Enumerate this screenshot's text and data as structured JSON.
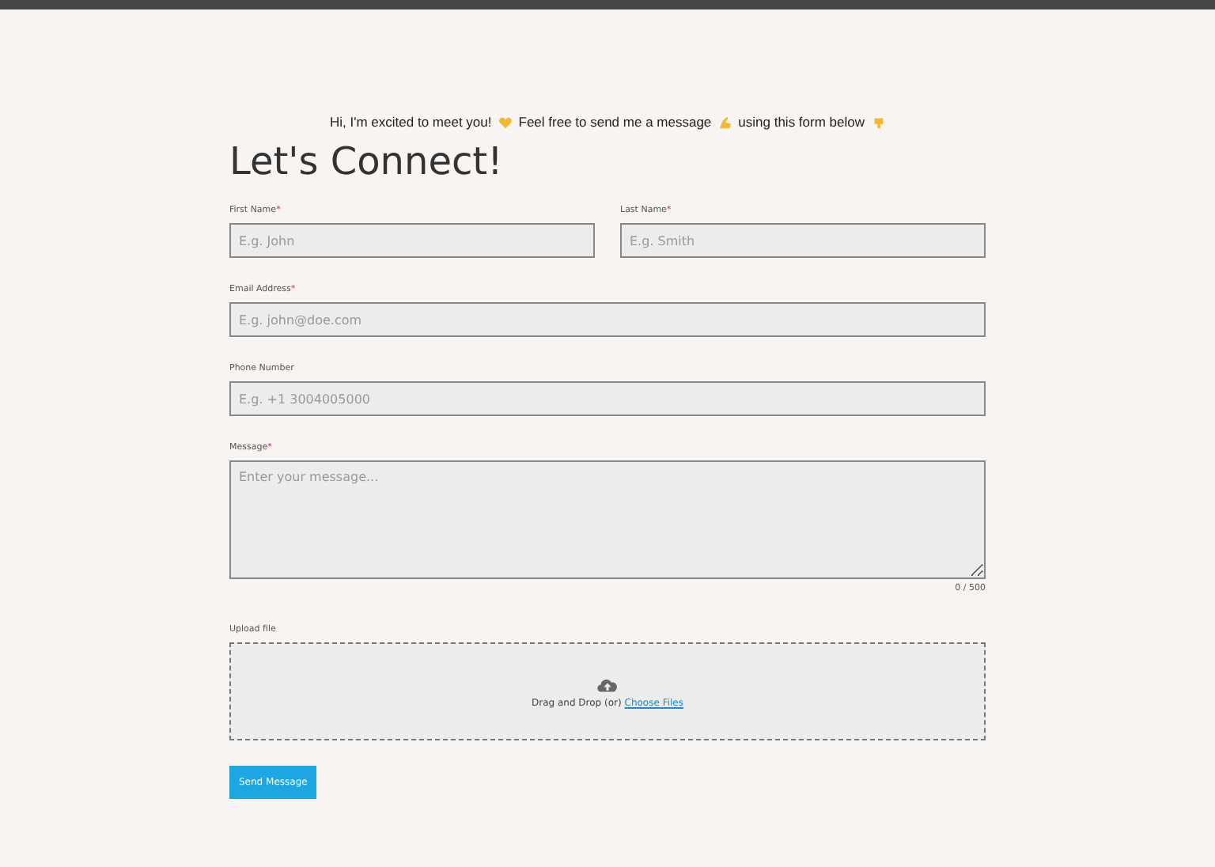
{
  "intro": [
    {
      "kind": "text",
      "text": "Hi, I'm excited to meet you!"
    },
    {
      "kind": "heart"
    },
    {
      "kind": "text",
      "text": "Feel free to send me a message"
    },
    {
      "kind": "hand"
    },
    {
      "kind": "text",
      "text": "using this form below"
    },
    {
      "kind": "point"
    }
  ],
  "title": "Let's Connect!",
  "rows": [
    [
      {
        "label": "First Name",
        "mark": "*",
        "placeholder": "E.g. John"
      },
      {
        "label": "Last Name",
        "mark": "*",
        "placeholder": "E.g. Smith"
      }
    ],
    [
      {
        "label": "Email Address",
        "mark": "*",
        "placeholder": "E.g. john@doe.com"
      }
    ],
    [
      {
        "label": "Phone Number",
        "placeholder": "E.g. +1 3004005000"
      }
    ]
  ],
  "message": {
    "label": "Message",
    "mark": "*",
    "placeholder": "Enter your message...",
    "counter": "0 / 500"
  },
  "upload": {
    "label": "Upload file",
    "text": "Drag and Drop (or)",
    "link": "Choose Files"
  },
  "submit": "Send Message"
}
